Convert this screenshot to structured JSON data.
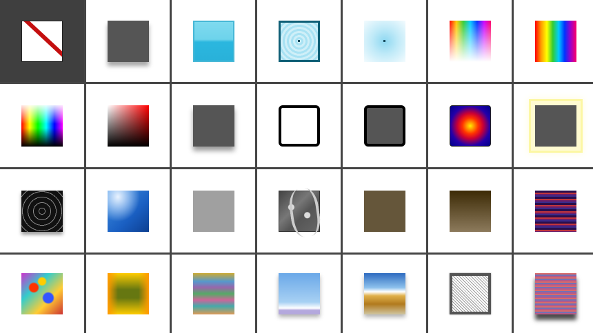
{
  "style_grid": {
    "selected_index": 0,
    "swatches": [
      {
        "name": "style-none",
        "cls": "s-none"
      },
      {
        "name": "style-drop-shadow",
        "cls": "s-shadow"
      },
      {
        "name": "style-glossy-blue",
        "cls": "s-glossy"
      },
      {
        "name": "style-blue-frame",
        "cls": "s-frame"
      },
      {
        "name": "style-blue-fade",
        "cls": "s-fade"
      },
      {
        "name": "style-rainbow-fade",
        "cls": "s-rainbow-fade"
      },
      {
        "name": "style-rainbow",
        "cls": "s-rainbow"
      },
      {
        "name": "style-spectrum",
        "cls": "s-spectrum"
      },
      {
        "name": "style-red-gradient",
        "cls": "s-red"
      },
      {
        "name": "style-drop-shadow-2",
        "cls": "s-shadow2"
      },
      {
        "name": "style-outline",
        "cls": "s-outline"
      },
      {
        "name": "style-outline-fill",
        "cls": "s-outline-fill"
      },
      {
        "name": "style-radial-blue",
        "cls": "s-radial"
      },
      {
        "name": "style-outer-glow",
        "cls": "s-glow"
      },
      {
        "name": "style-concentric-rings",
        "cls": "s-rings"
      },
      {
        "name": "style-blue-light",
        "cls": "s-blue-light"
      },
      {
        "name": "style-gray",
        "cls": "s-gray"
      },
      {
        "name": "style-gray-marble",
        "cls": "s-marble"
      },
      {
        "name": "style-brown",
        "cls": "s-brown"
      },
      {
        "name": "style-brown-gradient",
        "cls": "s-brown-grad"
      },
      {
        "name": "style-stripes",
        "cls": "s-stripes"
      },
      {
        "name": "style-psychedelic",
        "cls": "s-psyche"
      },
      {
        "name": "style-orange-green",
        "cls": "s-orange-green"
      },
      {
        "name": "style-wave",
        "cls": "s-wave"
      },
      {
        "name": "style-sky",
        "cls": "s-sky"
      },
      {
        "name": "style-landscape",
        "cls": "s-landscape"
      },
      {
        "name": "style-noise",
        "cls": "s-noise"
      },
      {
        "name": "style-lines",
        "cls": "s-lines"
      }
    ]
  }
}
